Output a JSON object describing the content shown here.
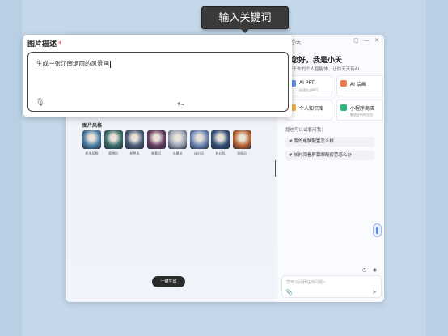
{
  "tooltip": {
    "text": "输入关键词"
  },
  "assistant": {
    "header_title": "小天",
    "header_icons": "▢ — ✕",
    "greeting": "您好，我是小天",
    "greeting_sub": "I于你的个人智能体，让你天天有AI",
    "cards": [
      {
        "title": "AI PPT",
        "sub": "快速生成PPT",
        "color": "#5b8def"
      },
      {
        "title": "AI 绘画",
        "sub": "",
        "color": "#f07a4a"
      },
      {
        "title": "个人知识库",
        "sub": "",
        "color": "#f3b23a"
      },
      {
        "title": "小程序商店",
        "sub": "解锁全新的应用",
        "color": "#2fb67a"
      }
    ],
    "suggest_title": "您也可以试着问我：",
    "suggestions": [
      "# 我的电脑配置怎么样",
      "# 长时间看屏幕眼睛疲劳怎么办"
    ],
    "input_placeholder": "您可以问我任何问题~",
    "mini_icons": "◷ ◉"
  },
  "left_panel": {
    "style_title": "图片风格",
    "styles": [
      {
        "label": "航海风格",
        "color": "#4b7fa6"
      },
      {
        "label": "赛博风",
        "color": "#3a6f6a"
      },
      {
        "label": "机甲风",
        "color": "#4a5e7a"
      },
      {
        "label": "像素风",
        "color": "#6a3f64"
      },
      {
        "label": "水墨风",
        "color": "#9aa3b4"
      },
      {
        "label": "迷幻风",
        "color": "#6c86b8"
      },
      {
        "label": "科幻风",
        "color": "#34507a"
      },
      {
        "label": "漫画风",
        "color": "#b8622f"
      }
    ],
    "generate_label": "一键生成"
  },
  "popup": {
    "label": "图片描述",
    "required_mark": "*",
    "value": "生成一张江南烟雨的风景画"
  }
}
